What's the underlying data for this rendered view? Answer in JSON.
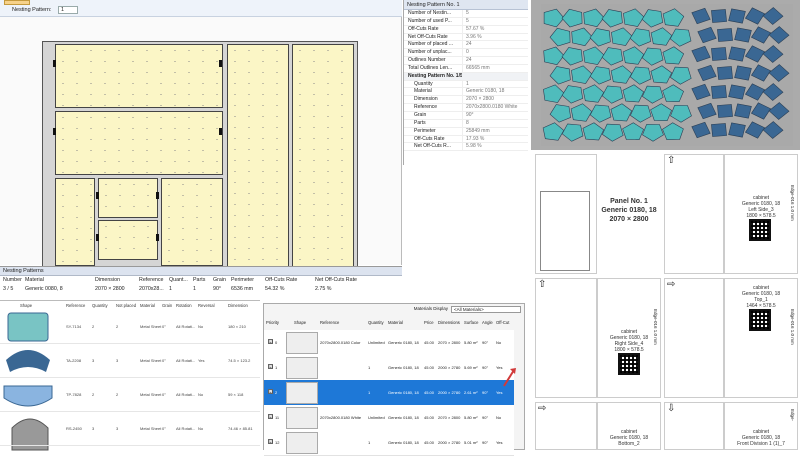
{
  "toolbar": {
    "label": "Nesting Pattern:",
    "value": "1"
  },
  "properties": {
    "header": "Nesting Pattern No. 1",
    "rows": [
      {
        "k": "Number of Nestin...",
        "v": "5"
      },
      {
        "k": "Number of used P...",
        "v": "5"
      },
      {
        "k": "Off-Cuts Rate",
        "v": "57.67 %"
      },
      {
        "k": "Net Off-Cuts Rate",
        "v": "3.96 %"
      },
      {
        "k": "Number of placed ...",
        "v": "24"
      },
      {
        "k": "Number of unplac...",
        "v": "0"
      },
      {
        "k": "Outlines Number",
        "v": "24"
      },
      {
        "k": "Total Outlines Len...",
        "v": "66565 mm"
      }
    ],
    "section": "Nesting Pattern No. 1/5",
    "sub_rows": [
      {
        "k": "Quantity",
        "v": "1"
      },
      {
        "k": "Material",
        "v": "Generic 0180, 18"
      },
      {
        "k": "Dimension",
        "v": "2070 × 2800"
      },
      {
        "k": "Reference",
        "v": "2070x2800.0180 White"
      },
      {
        "k": "Grain",
        "v": "90°"
      },
      {
        "k": "Parts",
        "v": "8"
      },
      {
        "k": "Perimeter",
        "v": "25849 mm"
      },
      {
        "k": "Off-Cuts Rate",
        "v": "17.93 %"
      },
      {
        "k": "Net Off-Cuts R...",
        "v": "5.98 %"
      }
    ]
  },
  "nesting_patterns": {
    "title": "Nesting Patterns",
    "columns": [
      "Number",
      "Material",
      "Dimension",
      "Reference",
      "Quant...",
      "Parts",
      "Grain",
      "Perimeter",
      "Off-Cuts Rate",
      "Net Off-Cuts Rate"
    ],
    "row": [
      "3 / 5",
      "Generic 0080, 8",
      "2070 × 2800",
      "2070x28...",
      "1",
      "1",
      "90°",
      "6536 mm",
      "54.32 %",
      "2.75 %"
    ]
  },
  "parts_list": {
    "columns": [
      "Shape",
      "Reference",
      "Quantity",
      "Not placed",
      "Material",
      "Grain",
      "Rotation",
      "Reversal",
      "Dimension"
    ],
    "rows": [
      {
        "ref": "SY-7134",
        "qty": "2",
        "np": "2",
        "mat": "Metal Sheet",
        "grain": "0°",
        "rot": "All Rotati...",
        "rev": "No",
        "dim": "180 × 210"
      },
      {
        "ref": "TA-2208",
        "qty": "3",
        "np": "3",
        "mat": "Metal Sheet",
        "grain": "0°",
        "rot": "All Rotati...",
        "rev": "Yes",
        "dim": "74.5 × 123.2"
      },
      {
        "ref": "TP-7828",
        "qty": "2",
        "np": "2",
        "mat": "Metal Sheet",
        "grain": "0°",
        "rot": "All Rotati...",
        "rev": "No",
        "dim": "59 × 118"
      },
      {
        "ref": "RS-2450",
        "qty": "3",
        "np": "3",
        "mat": "Metal Sheet",
        "grain": "0°",
        "rot": "All Rotati...",
        "rev": "No",
        "dim": "74.46 × 85.81"
      }
    ]
  },
  "materials": {
    "display_label": "Materials Display",
    "display_value": "<All Materials>",
    "columns": [
      "Priority",
      "Shape",
      "Reference",
      "Quantity",
      "Material",
      "Price",
      "Dimensions",
      "Surface",
      "Angle",
      "Off-Cut"
    ],
    "rows": [
      {
        "check": "☑",
        "pri": "0",
        "ref": "2070x2800.0180 Color",
        "qty": "Unlimited",
        "mat": "Generic 0180, 18",
        "price": "45.00",
        "dim": "2070 × 2800",
        "surf": "5.80 m²",
        "angle": "90°",
        "off": "No"
      },
      {
        "check": "☑",
        "pri": "1",
        "ref": "",
        "qty": "1",
        "mat": "Generic 0180, 18",
        "price": "45.00",
        "dim": "2000 × 2780",
        "surf": "5.69 m²",
        "angle": "90°",
        "off": "Yes"
      },
      {
        "check": "☑",
        "pri": "2",
        "ref": "",
        "qty": "1",
        "mat": "Generic 0180, 18",
        "price": "45.00",
        "dim": "2000 × 2780",
        "surf": "2.61 m²",
        "angle": "90°",
        "off": "Yes"
      },
      {
        "check": "☑",
        "pri": "11",
        "ref": "2070x2800.0180 White",
        "qty": "Unlimited",
        "mat": "Generic 0180, 18",
        "price": "45.00",
        "dim": "2070 × 2800",
        "surf": "5.80 m²",
        "angle": "90°",
        "off": "No"
      },
      {
        "check": "☑",
        "pri": "12",
        "ref": "",
        "qty": "1",
        "mat": "Generic 0180, 18",
        "price": "45.00",
        "dim": "2000 × 2780",
        "surf": "5.01 m²",
        "angle": "90°",
        "off": "Yes"
      }
    ]
  },
  "labels": {
    "panel_title": "Panel No. 1",
    "panel_material": "Generic 0180, 18",
    "panel_dim": "2070 × 2800",
    "cards": [
      {
        "l1": "cabinet",
        "l2": "Generic 0180, 18",
        "l3": "Left Side_3",
        "l4": "1800 × 578.5",
        "edge": "Edge-016 1.0 mm"
      },
      {
        "l1": "cabinet",
        "l2": "Generic 0180, 18",
        "l3": "Right Side_4",
        "l4": "1800 × 578.5",
        "edge": "Edge-016 1.0 mm"
      },
      {
        "l1": "cabinet",
        "l2": "Generic 0180, 18",
        "l3": "Top_1",
        "l4": "1464 × 578.5",
        "edge": "Edge-016 1.0 mm"
      },
      {
        "l1": "cabinet",
        "l2": "Generic 0180, 18",
        "l3": "Bottom_2",
        "l4": "",
        "edge": ""
      },
      {
        "l1": "cabinet",
        "l2": "Generic 0180, 18",
        "l3": "Front Division 1 (1)_7",
        "l4": "",
        "edge": "Edge-"
      }
    ]
  },
  "colors": {
    "teal": "#4fbcbc",
    "steel": "#3a6793",
    "accent": "#1e78d7"
  }
}
